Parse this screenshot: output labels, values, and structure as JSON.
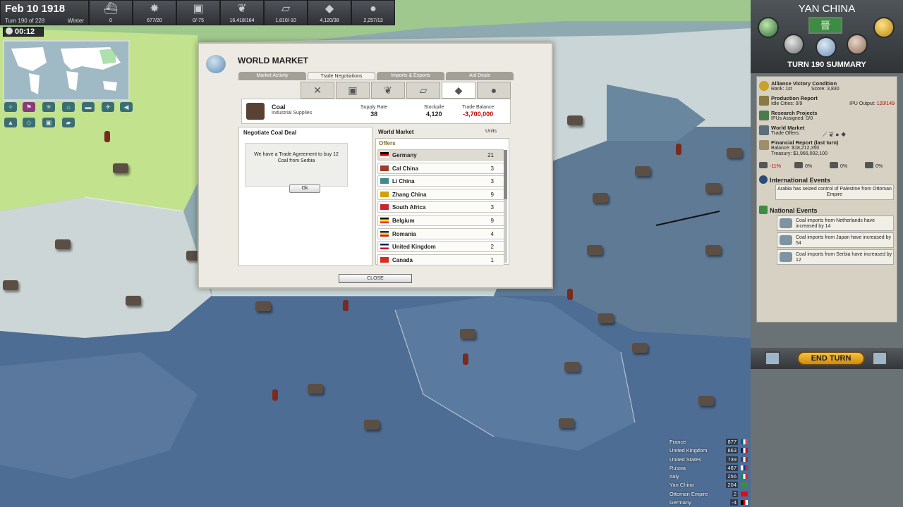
{
  "topbar": {
    "date": "Feb 10 1918",
    "turn": "Turn 190 of 228",
    "season": "Winter",
    "timer": "00:12",
    "resources": [
      {
        "icon": "warship-icon",
        "glyph": "⛴",
        "value": "0"
      },
      {
        "icon": "military-icon",
        "glyph": "✸",
        "value": "677/20"
      },
      {
        "icon": "steel-icon",
        "glyph": "▣",
        "value": "0/-75"
      },
      {
        "icon": "food-icon",
        "glyph": "❦",
        "value": "16,418/164"
      },
      {
        "icon": "metal-icon",
        "glyph": "▱",
        "value": "1,810/-10"
      },
      {
        "icon": "coal-icon",
        "glyph": "◆",
        "value": "4,120/38"
      },
      {
        "icon": "oil-icon",
        "glyph": "●",
        "value": "2,257/13"
      }
    ]
  },
  "market": {
    "title": "WORLD MARKET",
    "tabs": [
      "Market Activity",
      "Trade Negotiations",
      "Imports & Exports",
      "Aid Deals"
    ],
    "active_tab": 1,
    "resource_tabs": [
      "✕",
      "▣",
      "❦",
      "▱",
      "◆",
      "●"
    ],
    "resource_tab_icons": [
      "military-icon",
      "steel-icon",
      "food-icon",
      "metal-icon",
      "coal-icon",
      "oil-icon"
    ],
    "active_resource_tab": 4,
    "commodity": {
      "name": "Coal",
      "category": "Industrial Supplies"
    },
    "stats": {
      "supply_rate_label": "Supply Rate",
      "supply_rate": "38",
      "stockpile_label": "Stockpile",
      "stockpile": "4,120",
      "balance_label": "Trade Balance",
      "balance": "-3,700,000"
    },
    "deal_heading": "Negotiate Coal Deal",
    "deal_message": "We have a Trade Agreement to buy 12 Coal from Serbia",
    "ok_label": "Ok",
    "wm_heading": "World Market",
    "units_heading": "Units",
    "offers_heading": "Offers",
    "offers": [
      {
        "country": "Germany",
        "units": "21",
        "flag": [
          "#000000",
          "#dd0000",
          "#ffffff"
        ],
        "selected": true
      },
      {
        "country": "Cal China",
        "units": "3",
        "flag": [
          "#a23a2a",
          "#a23a2a",
          "#a23a2a"
        ]
      },
      {
        "country": "Li China",
        "units": "3",
        "flag": [
          "#3f8a8f",
          "#3f8a8f",
          "#3f8a8f"
        ]
      },
      {
        "country": "Zhang China",
        "units": "9",
        "flag": [
          "#d8a000",
          "#d8a000",
          "#d8a000"
        ]
      },
      {
        "country": "South Africa",
        "units": "3",
        "flag": [
          "#cc2233",
          "#cc2233",
          "#cc2233"
        ]
      },
      {
        "country": "Belgium",
        "units": "9",
        "flag": [
          "#000000",
          "#fdda24",
          "#ef3340"
        ]
      },
      {
        "country": "Romania",
        "units": "4",
        "flag": [
          "#002b7f",
          "#fcd116",
          "#ce1126"
        ]
      },
      {
        "country": "United Kingdom",
        "units": "2",
        "flag": [
          "#012169",
          "#ffffff",
          "#c8102e"
        ]
      },
      {
        "country": "Canada",
        "units": "1",
        "flag": [
          "#d52b1e",
          "#d52b1e",
          "#d52b1e"
        ]
      }
    ],
    "close_label": "CLOSE"
  },
  "right": {
    "nation": "YAN CHINA",
    "flag_glyph": "晉",
    "turn_summary": "TURN 190 SUMMARY",
    "alliance": {
      "title": "Alliance Victory Condition",
      "rank": "Rank: 1st",
      "score": "Score: 3,830"
    },
    "production": {
      "title": "Production Report",
      "idle": "Idle Cities: 0/9",
      "ipu_label": "IPU Output: ",
      "ipu_value": "120/149"
    },
    "research": {
      "title": "Research Projects",
      "ipus": "IPUs Assigned: 0/0"
    },
    "world_market": {
      "title": "World Market",
      "offers": "Trade Offers:"
    },
    "financial": {
      "title": "Financial Report (last turn)",
      "balance": "Balance:  $18,212,350",
      "treasury": "Treasury:  $1,966,002,100"
    },
    "mods": [
      "-11%",
      "0%",
      "0%",
      "0%"
    ],
    "intl_heading": "International Events",
    "intl_events": [
      "Arabia has seized control of Palestine from Ottoman Empire"
    ],
    "natl_heading": "National Events",
    "natl_events": [
      "Coal imports from Netherlands have increased by 14",
      "Coal imports from Japan have increased by 54",
      "Coal imports from Serbia have increased by 12"
    ],
    "end_turn": "END TURN"
  },
  "ranking": [
    {
      "country": "France",
      "score": "877",
      "flag": [
        "#0055a4",
        "#ffffff",
        "#ef4135"
      ]
    },
    {
      "country": "United Kingdom",
      "score": "863",
      "flag": [
        "#012169",
        "#ffffff",
        "#c8102e"
      ]
    },
    {
      "country": "United States",
      "score": "739",
      "flag": [
        "#3c3b6e",
        "#ffffff",
        "#b22234"
      ]
    },
    {
      "country": "Russia",
      "score": "487",
      "flag": [
        "#ffffff",
        "#0039a6",
        "#d52b1e"
      ]
    },
    {
      "country": "Italy",
      "score": "256",
      "flag": [
        "#009246",
        "#ffffff",
        "#ce2b37"
      ]
    },
    {
      "country": "Yan China",
      "score": "204",
      "flag": [
        "#3d8c44",
        "#3d8c44",
        "#3d8c44"
      ]
    },
    {
      "country": "Ottoman Empire",
      "score": "2",
      "flag": [
        "#e30a17",
        "#e30a17",
        "#e30a17"
      ]
    },
    {
      "country": "Germany",
      "score": "-4",
      "flag": [
        "#000000",
        "#dd0000",
        "#ffffff"
      ]
    }
  ]
}
